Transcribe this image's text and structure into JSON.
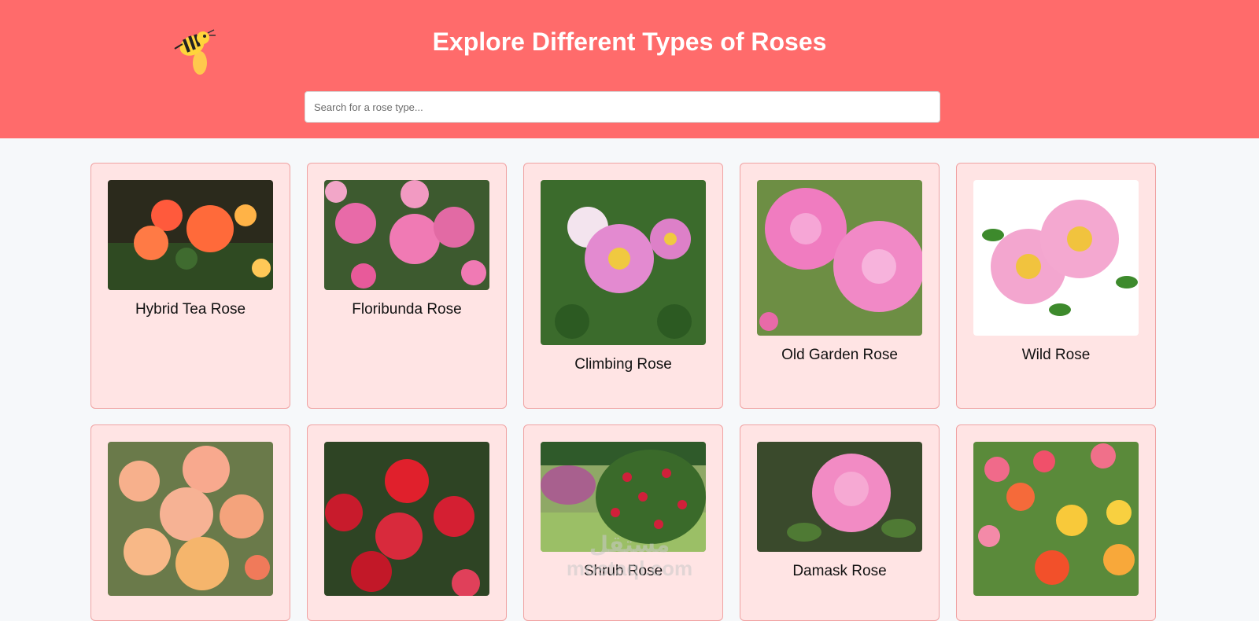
{
  "header": {
    "title": "Explore Different Types of Roses",
    "logo_icon": "bee-icon",
    "colors": {
      "header_bg": "#ff6b6b",
      "card_bg": "#ffe4e4",
      "card_border": "#f0a2a2"
    }
  },
  "search": {
    "placeholder": "Search for a rose type...",
    "value": ""
  },
  "roses": [
    {
      "name": "Hybrid Tea Rose"
    },
    {
      "name": "Floribunda Rose"
    },
    {
      "name": "Climbing Rose"
    },
    {
      "name": "Old Garden Rose"
    },
    {
      "name": "Wild Rose"
    },
    {
      "name": ""
    },
    {
      "name": ""
    },
    {
      "name": "Shrub Rose"
    },
    {
      "name": "Damask Rose"
    },
    {
      "name": ""
    }
  ],
  "watermark": {
    "line1": "مستقل",
    "line2": "mostaql.com"
  }
}
